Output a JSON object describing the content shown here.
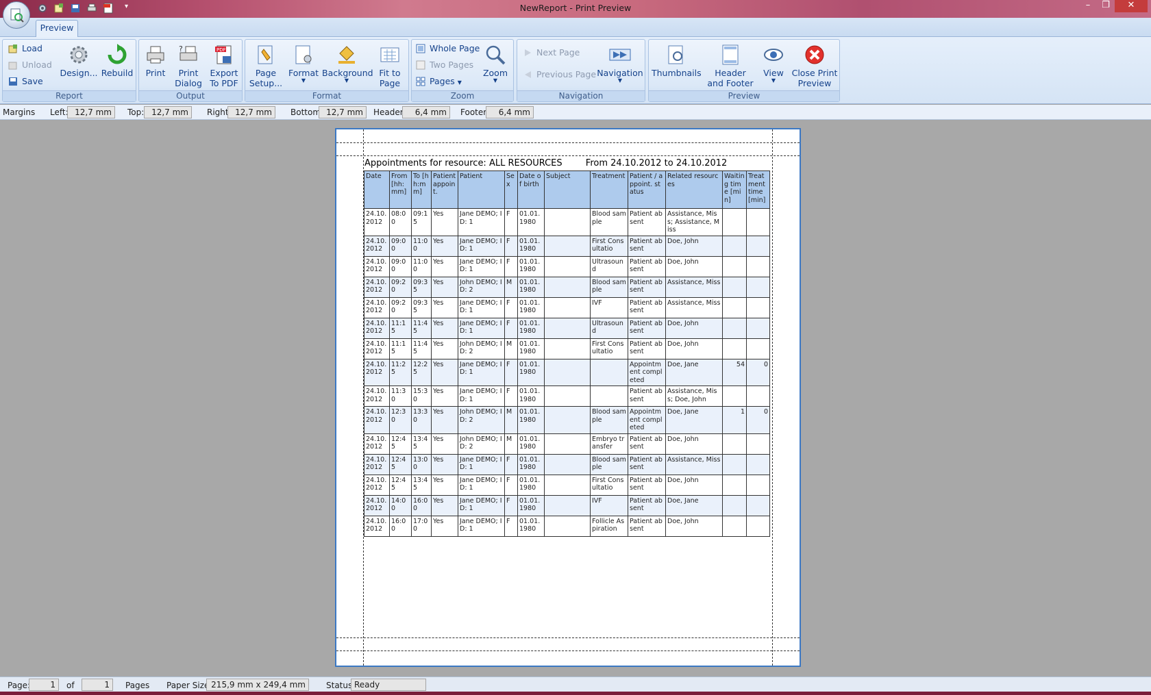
{
  "window": {
    "title": "NewReport - Print Preview"
  },
  "ribbon": {
    "tab": "Preview",
    "groups": {
      "report": {
        "label": "Report",
        "load": "Load",
        "unload": "Unload",
        "save": "Save",
        "design": "Design...",
        "rebuild": "Rebuild"
      },
      "output": {
        "label": "Output",
        "print": "Print",
        "print_dialog_1": "Print",
        "print_dialog_2": "Dialog",
        "export_1": "Export",
        "export_2": "To PDF"
      },
      "format": {
        "label": "Format",
        "page_setup_1": "Page",
        "page_setup_2": "Setup...",
        "format": "Format",
        "background": "Background",
        "fit_1": "Fit to",
        "fit_2": "Page"
      },
      "zoom": {
        "label": "Zoom",
        "whole_page": "Whole Page",
        "two_pages": "Two Pages",
        "pages": "Pages",
        "zoom": "Zoom"
      },
      "navigation": {
        "label": "Navigation",
        "next_page": "Next Page",
        "previous_page": "Previous Page",
        "navigation": "Navigation"
      },
      "preview": {
        "label": "Preview",
        "thumbnails": "Thumbnails",
        "header_footer_1": "Header",
        "header_footer_2": "and Footer",
        "view": "View",
        "close_1": "Close Print",
        "close_2": "Preview"
      }
    }
  },
  "margins": {
    "label": "Margins",
    "left_label": "Left:",
    "left": "12,7 mm",
    "top_label": "Top:",
    "top": "12,7 mm",
    "right_label": "Right:",
    "right": "12,7 mm",
    "bottom_label": "Bottom:",
    "bottom": "12,7 mm",
    "header_label": "Header:",
    "header": "6,4 mm",
    "footer_label": "Footer:",
    "footer": "6,4 mm"
  },
  "report": {
    "title": "Appointments for resource: ALL RESOURCES",
    "range": "From 24.10.2012 to 24.10.2012",
    "columns": [
      "Date",
      "From [hh:mm]",
      "To [hh:mm]",
      "Patient appoint.",
      "Patient",
      "Sex",
      "Date of birth",
      "Subject",
      "Treatment",
      "Patient / appoint. status",
      "Related resources",
      "Waiting time [min]",
      "Treatment time [min]"
    ],
    "rows": [
      [
        "24.10.2012",
        "08:00",
        "09:15",
        "Yes",
        "Jane DEMO; ID: 1",
        "F",
        "01.01.1980",
        "",
        "Blood sample",
        "Patient absent",
        "Assistance, Miss; Assistance, Miss",
        "",
        ""
      ],
      [
        "24.10.2012",
        "09:00",
        "11:00",
        "Yes",
        "Jane DEMO; ID: 1",
        "F",
        "01.01.1980",
        "",
        "First Consultatio",
        "Patient absent",
        "Doe, John",
        "",
        ""
      ],
      [
        "24.10.2012",
        "09:00",
        "11:00",
        "Yes",
        "Jane DEMO; ID: 1",
        "F",
        "01.01.1980",
        "",
        "Ultrasound",
        "Patient absent",
        "Doe, John",
        "",
        ""
      ],
      [
        "24.10.2012",
        "09:20",
        "09:35",
        "Yes",
        "John DEMO; ID: 2",
        "M",
        "01.01.1980",
        "",
        "Blood sample",
        "Patient absent",
        "Assistance, Miss",
        "",
        ""
      ],
      [
        "24.10.2012",
        "09:20",
        "09:35",
        "Yes",
        "Jane DEMO; ID: 1",
        "F",
        "01.01.1980",
        "",
        "IVF",
        "Patient absent",
        "Assistance, Miss",
        "",
        ""
      ],
      [
        "24.10.2012",
        "11:15",
        "11:45",
        "Yes",
        "Jane DEMO; ID: 1",
        "F",
        "01.01.1980",
        "",
        "Ultrasound",
        "Patient absent",
        "Doe, John",
        "",
        ""
      ],
      [
        "24.10.2012",
        "11:15",
        "11:45",
        "Yes",
        "John DEMO; ID: 2",
        "M",
        "01.01.1980",
        "",
        "First Consultatio",
        "Patient absent",
        "Doe, John",
        "",
        ""
      ],
      [
        "24.10.2012",
        "11:25",
        "12:25",
        "Yes",
        "Jane DEMO; ID: 1",
        "F",
        "01.01.1980",
        "",
        "",
        "Appointment completed",
        "Doe, Jane",
        "54",
        "0"
      ],
      [
        "24.10.2012",
        "11:30",
        "15:30",
        "Yes",
        "Jane DEMO; ID: 1",
        "F",
        "01.01.1980",
        "",
        "",
        "Patient absent",
        "Assistance, Miss; Doe, John",
        "",
        ""
      ],
      [
        "24.10.2012",
        "12:30",
        "13:30",
        "Yes",
        "John DEMO; ID: 2",
        "M",
        "01.01.1980",
        "",
        "Blood sample",
        "Appointment completed",
        "Doe, Jane",
        "1",
        "0"
      ],
      [
        "24.10.2012",
        "12:45",
        "13:45",
        "Yes",
        "John DEMO; ID: 2",
        "M",
        "01.01.1980",
        "",
        "Embryo transfer",
        "Patient absent",
        "Doe, John",
        "",
        ""
      ],
      [
        "24.10.2012",
        "12:45",
        "13:00",
        "Yes",
        "Jane DEMO; ID: 1",
        "F",
        "01.01.1980",
        "",
        "Blood sample",
        "Patient absent",
        "Assistance, Miss",
        "",
        ""
      ],
      [
        "24.10.2012",
        "12:45",
        "13:45",
        "Yes",
        "Jane DEMO; ID: 1",
        "F",
        "01.01.1980",
        "",
        "First Consultatio",
        "Patient absent",
        "Doe, John",
        "",
        ""
      ],
      [
        "24.10.2012",
        "14:00",
        "16:00",
        "Yes",
        "Jane DEMO; ID: 1",
        "F",
        "01.01.1980",
        "",
        "IVF",
        "Patient absent",
        "Doe, Jane",
        "",
        ""
      ],
      [
        "24.10.2012",
        "16:00",
        "17:00",
        "Yes",
        "Jane DEMO; ID: 1",
        "F",
        "01.01.1980",
        "",
        "Follicle Aspiration",
        "Patient absent",
        "Doe, John",
        "",
        ""
      ]
    ]
  },
  "statusbar": {
    "page_label": "Page:",
    "page": "1",
    "of_label": "of",
    "total": "1",
    "pages_label": "Pages",
    "paper_label": "Paper Size:",
    "paper": "215,9 mm x 249,4 mm",
    "status_label": "Status:",
    "status": "Ready"
  },
  "icons": [
    "orb-icon",
    "gear-icon",
    "folder-icon",
    "save-icon",
    "print-icon",
    "pdf-icon",
    "rebuild-icon",
    "zoom-icon",
    "close-icon"
  ]
}
